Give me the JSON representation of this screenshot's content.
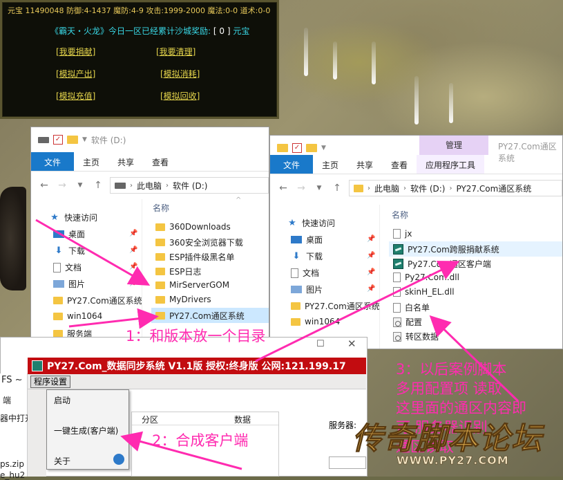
{
  "game": {
    "stats": "元宝 11490048 防御:4-1437 魔防:4-9 攻击:1999-2000 魔法:0-0 道术:0-0",
    "reward_prefix": "《霸天・火龙》今日一区已经累计沙城奖励:",
    "reward_bracket": "[   0 ]",
    "reward_unit": "元宝",
    "links": [
      "[我要捐献]",
      "[我要清理]",
      "[模拟产出]",
      "[模拟消耗]",
      "[模拟充值]",
      "[模拟回收]"
    ]
  },
  "explorer_left": {
    "tabs": [
      "文件",
      "主页",
      "共享",
      "查看"
    ],
    "title": "软件 (D:)",
    "breadcrumb": [
      "此电脑",
      "软件 (D:)"
    ],
    "column_name": "名称",
    "nav": [
      "快速访问",
      "桌面",
      "下载",
      "文档",
      "图片",
      "PY27.Com通区系统",
      "win1064",
      "服务端"
    ],
    "files": [
      "360Downloads",
      "360安全浏览器下载",
      "ESP插件级黑名单",
      "ESP日志",
      "MirServerGOM",
      "MyDrivers",
      "PY27.Com通区系统"
    ]
  },
  "explorer_right": {
    "tabs": [
      "文件",
      "主页",
      "共享",
      "查看"
    ],
    "context_group": "管理",
    "context_tab": "应用程序工具",
    "title": "PY27.Com通区系统",
    "breadcrumb": [
      "此电脑",
      "软件 (D:)",
      "PY27.Com通区系统"
    ],
    "column_name": "名称",
    "nav": [
      "快速访问",
      "桌面",
      "下载",
      "文档",
      "图片",
      "PY27.Com通区系统",
      "win1064"
    ],
    "files": [
      "jx",
      "PY27.Com跨服捐献系统",
      "Py27.Com通区客户端",
      "Py27.Com.dll",
      "skinH_EL.dll",
      "白名单",
      "配置",
      "转区数据"
    ]
  },
  "sync_app": {
    "title": "PY27.Com_数据同步系统 V1.1版   授权:终身版   公网:121.199.17",
    "menu": "程序设置",
    "menu_items": [
      "启动",
      "一键生成(客户端)",
      "关于"
    ],
    "columns": [
      "分区",
      "数据"
    ],
    "server_label": "服务器:",
    "side_texts": [
      "FS ~",
      "端",
      "器中打开",
      "ps.zip",
      "e_hu2"
    ]
  },
  "annotations": {
    "a1": "1：和版本放一个目录",
    "a2": "2：合成客户端",
    "a3_lines": [
      "3：以后案例脚本",
      "多用配置项 读取",
      "这里面的通区内容即",
      "可 服务器识别",
      "通区读取"
    ]
  },
  "watermark": {
    "title": "传奇脚本论坛",
    "url": "WWW.PY27.COM"
  },
  "colors": {
    "annotation": "#ff2bb0",
    "sync_title": "#c20c10",
    "file_tab": "#1979ca",
    "game_link": "#e6d64c"
  }
}
